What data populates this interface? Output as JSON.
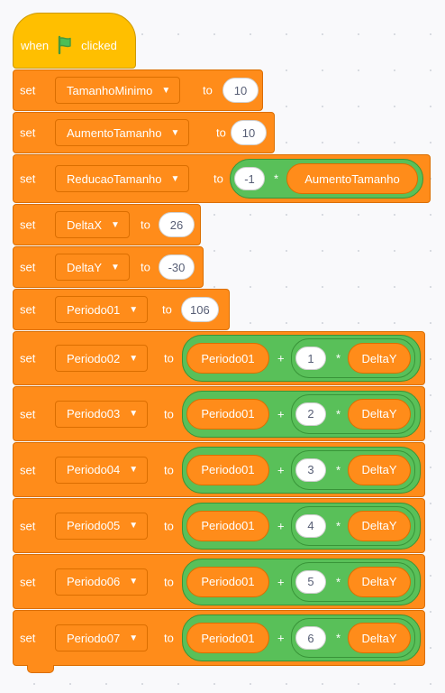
{
  "hat": {
    "when": "when",
    "clicked": "clicked",
    "icon": "green-flag-icon"
  },
  "labels": {
    "set": "set",
    "to": "to"
  },
  "blocks": {
    "b1": {
      "variable": "TamanhoMinimo",
      "value": "10"
    },
    "b2": {
      "variable": "AumentoTamanho",
      "value": "10"
    },
    "b3": {
      "variable": "ReducaoTamanho",
      "left": "-1",
      "op": "*",
      "right": "AumentoTamanho"
    },
    "b4": {
      "variable": "DeltaX",
      "value": "26"
    },
    "b5": {
      "variable": "DeltaY",
      "value": "-30"
    },
    "b6": {
      "variable": "Periodo01",
      "value": "106"
    },
    "b7": {
      "variable": "Periodo02",
      "base": "Periodo01",
      "plus": "+",
      "mult": "1",
      "times": "*",
      "delta": "DeltaY"
    },
    "b8": {
      "variable": "Periodo03",
      "base": "Periodo01",
      "plus": "+",
      "mult": "2",
      "times": "*",
      "delta": "DeltaY"
    },
    "b9": {
      "variable": "Periodo04",
      "base": "Periodo01",
      "plus": "+",
      "mult": "3",
      "times": "*",
      "delta": "DeltaY"
    },
    "b10": {
      "variable": "Periodo05",
      "base": "Periodo01",
      "plus": "+",
      "mult": "4",
      "times": "*",
      "delta": "DeltaY"
    },
    "b11": {
      "variable": "Periodo06",
      "base": "Periodo01",
      "plus": "+",
      "mult": "5",
      "times": "*",
      "delta": "DeltaY"
    },
    "b12": {
      "variable": "Periodo07",
      "base": "Periodo01",
      "plus": "+",
      "mult": "6",
      "times": "*",
      "delta": "DeltaY"
    }
  },
  "colors": {
    "events": "#ffbf00",
    "variables": "#ff8c1a",
    "operators": "#59c059",
    "flag": "#4cbf56",
    "canvas": "#f9f9fb"
  }
}
